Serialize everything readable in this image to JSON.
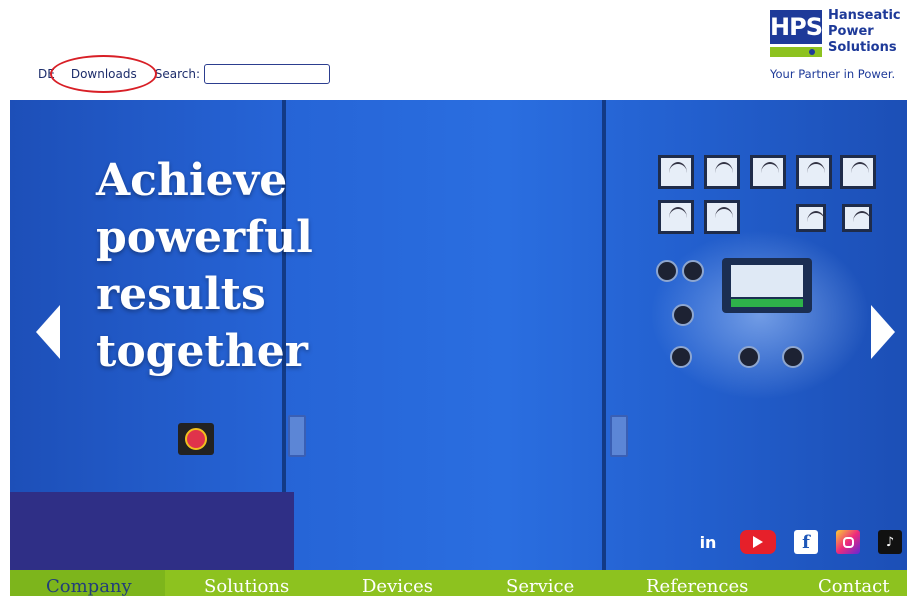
{
  "header": {
    "lang_link": "DE",
    "downloads_link": "Downloads",
    "search_label": "Search:",
    "search_value": "",
    "logo": {
      "abbrev": "HPS",
      "line1": "Hanseatic",
      "line2": "Power",
      "line3": "Solutions",
      "tagline": "Your Partner in Power."
    }
  },
  "hero": {
    "line1": "Achieve",
    "line2": "powerful",
    "line3": "results",
    "line4": "together",
    "prev_icon": "chevron-left-icon",
    "next_icon": "chevron-right-icon"
  },
  "social": {
    "linkedin": "in",
    "youtube": "youtube-icon",
    "facebook": "f",
    "instagram": "instagram-icon",
    "tiktok": "♪"
  },
  "nav": {
    "items": [
      "Company",
      "Solutions",
      "Devices",
      "Service",
      "References",
      "Contact"
    ],
    "active": "Company"
  },
  "colors": {
    "brand_blue": "#1e3a99",
    "brand_green": "#8dc21f",
    "annotation_red": "#d81f26"
  }
}
